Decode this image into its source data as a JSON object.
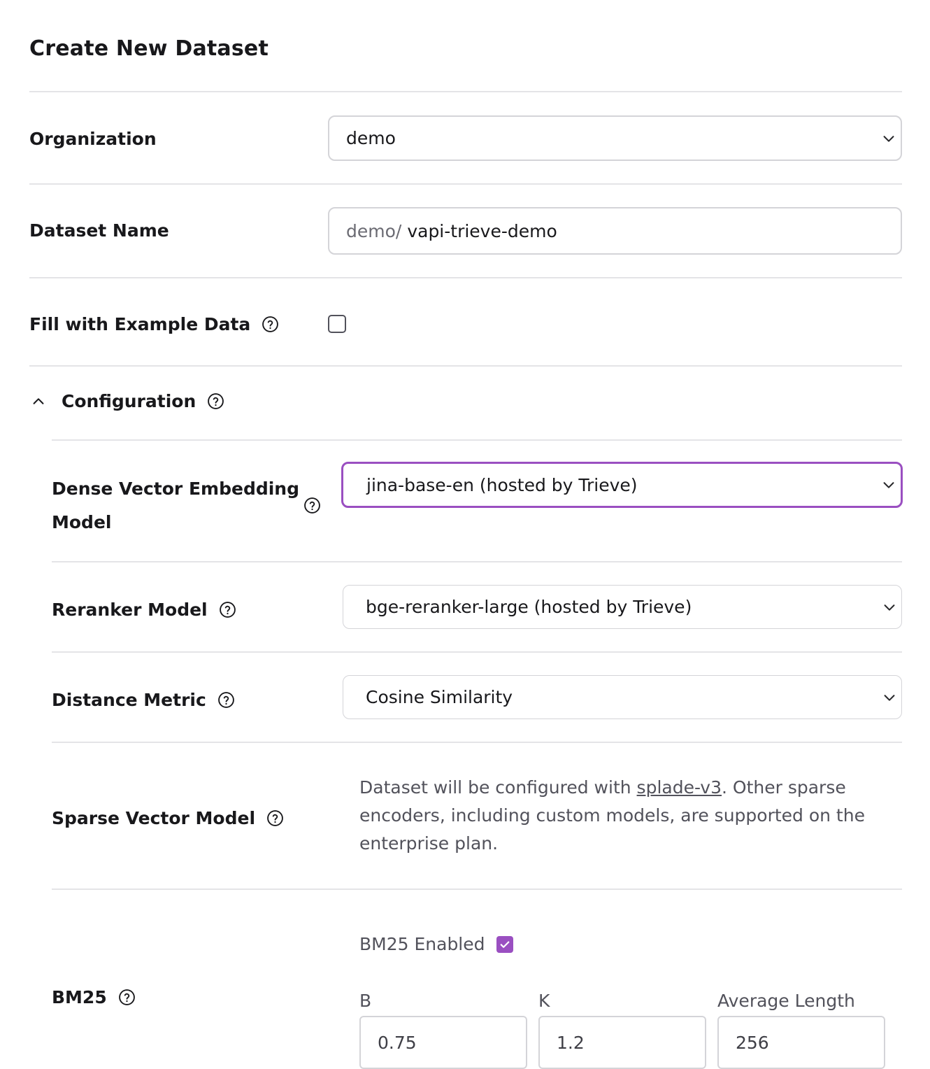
{
  "page": {
    "title": "Create New Dataset"
  },
  "organization": {
    "label": "Organization",
    "value": "demo"
  },
  "dataset_name": {
    "label": "Dataset Name",
    "prefix": "demo/",
    "value": "vapi-trieve-demo"
  },
  "example_data": {
    "label": "Fill with Example Data",
    "checked": false
  },
  "configuration": {
    "label": "Configuration",
    "expanded": true,
    "dense_model": {
      "label_line1": "Dense Vector Embedding",
      "label_line2": "Model",
      "value": "jina-base-en (hosted by Trieve)"
    },
    "reranker": {
      "label": "Reranker Model",
      "value": "bge-reranker-large (hosted by Trieve)"
    },
    "distance": {
      "label": "Distance Metric",
      "value": "Cosine Similarity"
    },
    "sparse": {
      "label": "Sparse Vector Model",
      "text_before": "Dataset will be configured with ",
      "link": "splade-v3",
      "text_after": ". Other sparse encoders, including custom models, are supported on the enterprise plan."
    },
    "bm25": {
      "label": "BM25",
      "enabled_label": "BM25 Enabled",
      "enabled": true,
      "b_label": "B",
      "b_value": "0.75",
      "k_label": "K",
      "k_value": "1.2",
      "avg_label": "Average Length",
      "avg_value": "256"
    }
  },
  "colors": {
    "accent": "#9a4fc1",
    "border": "#d4d4d8",
    "divider": "#e4e4e7"
  },
  "icons": {
    "help": "question-circle-icon",
    "dropdown": "chevron-down-icon",
    "collapse": "chevron-up-icon"
  }
}
